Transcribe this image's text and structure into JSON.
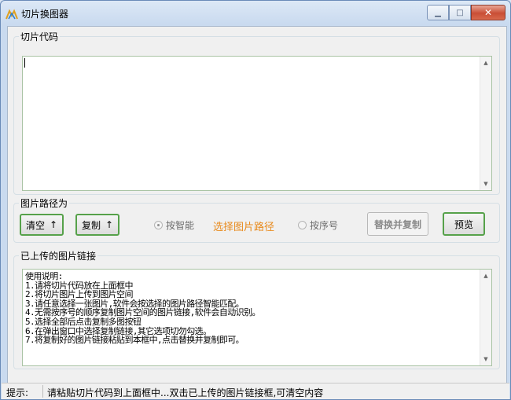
{
  "window": {
    "title": "切片换图器"
  },
  "controls": {
    "minimize": "▁",
    "maximize": "□",
    "close": "✕"
  },
  "code_group": {
    "legend": "切片代码",
    "value": ""
  },
  "path_group": {
    "legend": "图片路径为",
    "clear_label": "清空",
    "copy_label": "复制",
    "arrow": "↑",
    "radio_smart": "按智能",
    "select_path": "选择图片路径",
    "radio_order": "按序号",
    "replace_copy": "替换并复制",
    "preview": "预览"
  },
  "links_group": {
    "legend": "已上传的图片链接",
    "lines": [
      "使用说明:",
      "1.请将切片代码放在上面框中",
      "2.将切片图片上传到图片空间",
      "3.请任意选择一张图片,软件会按选择的图片路径智能匹配。",
      "4.无需按序号的顺序复制图片空间的图片链接,软件会自动识别。",
      "5.选择全部后点击复制多图按钮",
      "6.在弹出窗口中选择复制链接,其它选项切勿勾选。",
      "7.将复制好的图片链接粘贴到本框中,点击替换并复制即可。"
    ]
  },
  "status": {
    "label": "提示:",
    "text": "请粘贴切片代码到上面框中...双击已上传的图片链接框,可清空内容"
  }
}
